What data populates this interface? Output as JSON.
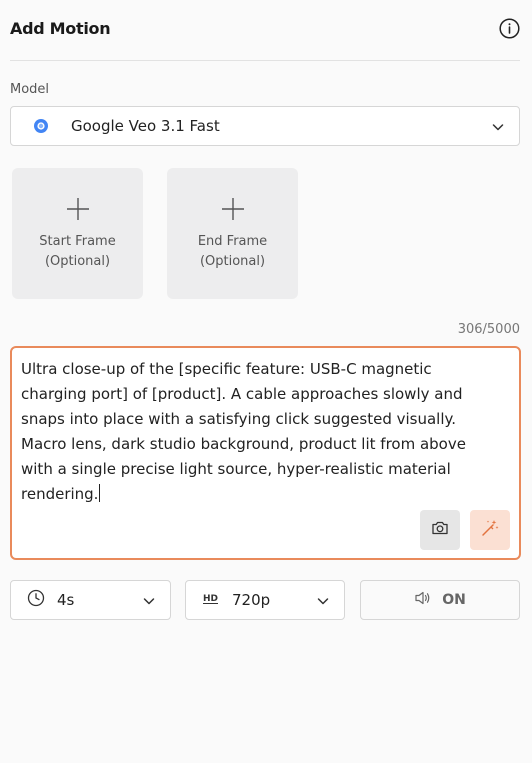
{
  "header": {
    "title": "Add Motion",
    "info_icon": "info-icon"
  },
  "model": {
    "label": "Model",
    "selected": "Google Veo 3.1 Fast",
    "logo_color": "#4285f4"
  },
  "frames": [
    {
      "label": "Start Frame\n(Optional)",
      "icon": "plus-icon"
    },
    {
      "label": "End Frame\n(Optional)",
      "icon": "plus-icon"
    }
  ],
  "prompt": {
    "counter": "306/5000",
    "text": "Ultra close-up of the [specific feature: USB-C magnetic charging port] of [product]. A cable approaches slowly and snaps into place with a satisfying click suggested visually. Macro lens, dark studio background, product lit from above with a single precise light source, hyper-realistic material rendering.",
    "border_color": "#e98a5b"
  },
  "options": {
    "duration": "4s",
    "resolution": "720p",
    "sound": "ON"
  }
}
